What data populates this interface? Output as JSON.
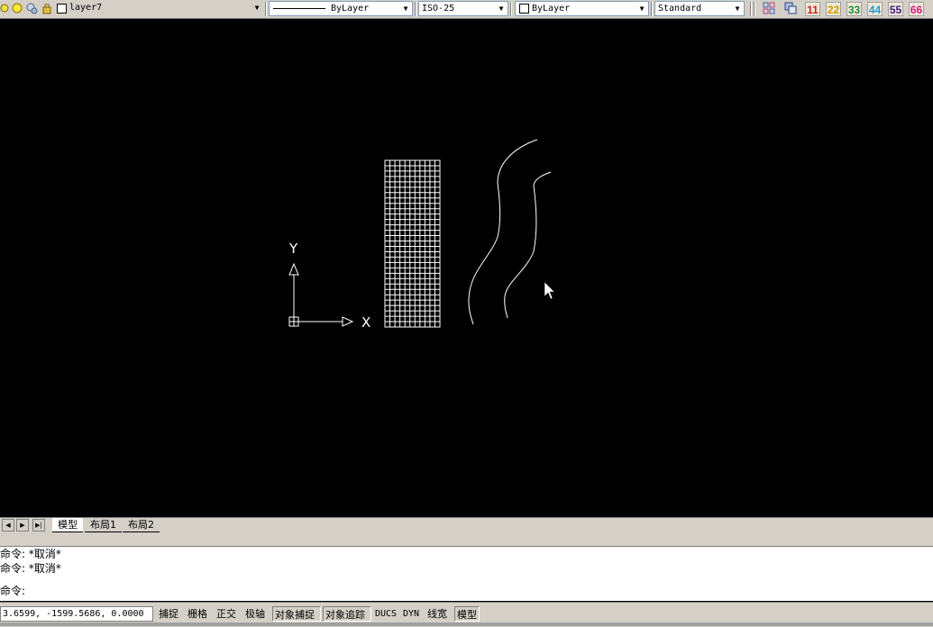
{
  "toolbar": {
    "layer_name": "layer7",
    "linetype": "ByLayer",
    "dimstyle": "ISO-25",
    "color": "ByLayer",
    "textstyle": "Standard",
    "layer_icons": [
      "lightbulb-icon",
      "sun-icon",
      "freeze-icon",
      "lock-icon"
    ],
    "tool_icons": [
      "layer-grid-icon",
      "layer-copy-icon"
    ],
    "number_buttons": [
      {
        "label": "11",
        "color": "#d02020"
      },
      {
        "label": "22",
        "color": "#d0a000"
      },
      {
        "label": "33",
        "color": "#209040"
      },
      {
        "label": "44",
        "color": "#20a0d0"
      },
      {
        "label": "55",
        "color": "#402080"
      },
      {
        "label": "66",
        "color": "#d02080"
      }
    ]
  },
  "ucs": {
    "x_label": "X",
    "y_label": "Y"
  },
  "tabs": {
    "model": "模型",
    "layout1": "布局1",
    "layout2": "布局2"
  },
  "command": {
    "history": [
      "命令: *取消*",
      "命令: *取消*"
    ],
    "prompt": "命令:"
  },
  "status": {
    "coords": "3.6599, -1599.5686, 0.0000",
    "buttons": [
      {
        "label": "捕捉",
        "on": false
      },
      {
        "label": "栅格",
        "on": false
      },
      {
        "label": "正交",
        "on": false
      },
      {
        "label": "极轴",
        "on": false
      },
      {
        "label": "对象捕捉",
        "on": true
      },
      {
        "label": "对象追踪",
        "on": true
      },
      {
        "label": "DUCS",
        "on": false
      },
      {
        "label": "DYN",
        "on": false
      },
      {
        "label": "线宽",
        "on": false
      },
      {
        "label": "模型",
        "on": true
      }
    ]
  },
  "colors": {
    "canvas_bg": "#000000",
    "entity": "#ffffff",
    "ui_face": "#d4d0c8"
  }
}
